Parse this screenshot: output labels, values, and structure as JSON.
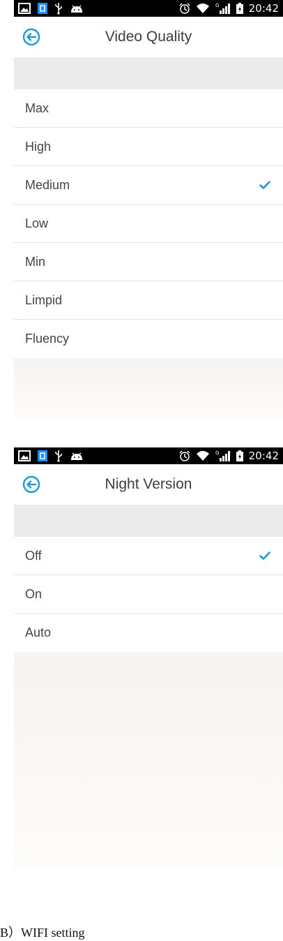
{
  "status_bar": {
    "time": "20:42",
    "network": "G"
  },
  "accent_color": "#1e9ad6",
  "screen1": {
    "title": "Video Quality",
    "back_icon": "back-arrow-circle-icon",
    "options": [
      {
        "label": "Max",
        "selected": false
      },
      {
        "label": "High",
        "selected": false
      },
      {
        "label": "Medium",
        "selected": true
      },
      {
        "label": "Low",
        "selected": false
      },
      {
        "label": "Min",
        "selected": false
      },
      {
        "label": "Limpid",
        "selected": false
      },
      {
        "label": "Fluency",
        "selected": false
      }
    ]
  },
  "screen2": {
    "title": "Night Version",
    "back_icon": "back-arrow-circle-icon",
    "options": [
      {
        "label": "Off",
        "selected": true
      },
      {
        "label": "On",
        "selected": false
      },
      {
        "label": "Auto",
        "selected": false
      }
    ]
  },
  "caption": "B）WIFI setting"
}
